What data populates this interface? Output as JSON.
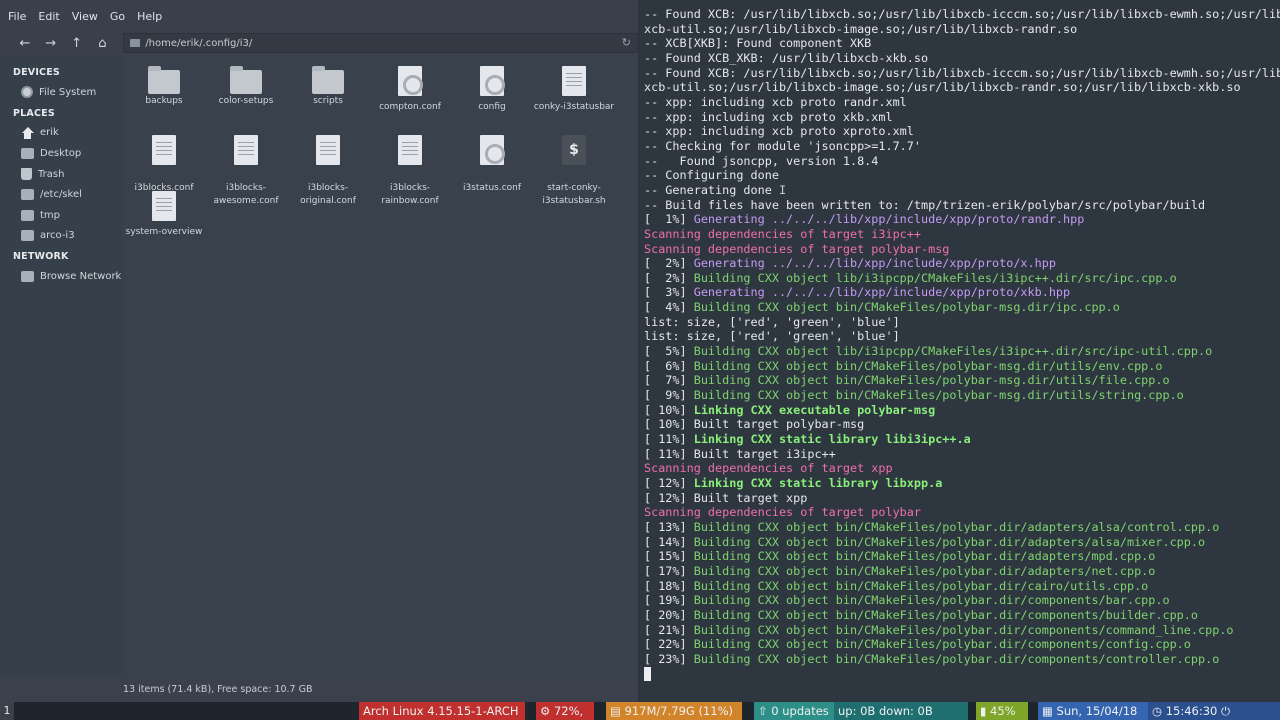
{
  "file_manager": {
    "menu": [
      "File",
      "Edit",
      "View",
      "Go",
      "Help"
    ],
    "path": "/home/erik/.config/i3/",
    "sidebar": {
      "devices_heading": "DEVICES",
      "devices": [
        "File System"
      ],
      "places_heading": "PLACES",
      "places": [
        "erik",
        "Desktop",
        "Trash",
        "/etc/skel",
        "tmp",
        "arco-i3"
      ],
      "network_heading": "NETWORK",
      "network": [
        "Browse Network"
      ]
    },
    "files": [
      {
        "name": "backups",
        "icon": "folder-icon"
      },
      {
        "name": "color-setups",
        "icon": "folder-icon"
      },
      {
        "name": "scripts",
        "icon": "folder-icon"
      },
      {
        "name": "compton.conf",
        "icon": "config-file-icon"
      },
      {
        "name": "config",
        "icon": "config-file-icon"
      },
      {
        "name": "conky-i3statusbar",
        "icon": "text-file-icon"
      },
      {
        "name": "i3blocks.conf",
        "icon": "text-file-icon"
      },
      {
        "name": "i3blocks-\nawesome.conf",
        "icon": "text-file-icon"
      },
      {
        "name": "i3blocks-\noriginal.conf",
        "icon": "text-file-icon"
      },
      {
        "name": "i3blocks-\nrainbow.conf",
        "icon": "text-file-icon"
      },
      {
        "name": "i3status.conf",
        "icon": "config-file-icon"
      },
      {
        "name": "start-conky-\ni3statusbar.sh",
        "icon": "shell-script-icon"
      },
      {
        "name": "system-overview",
        "icon": "text-file-icon"
      }
    ],
    "status": "13 items (71.4 kB), Free space: 10.7 GB"
  },
  "terminal": {
    "lines": [
      [
        [
          "",
          "-- Found XCB: /usr/lib/libxcb.so;/usr/lib/libxcb-icccm.so;/usr/lib/libxcb-ewmh.so;/usr/lib/lib"
        ]
      ],
      [
        [
          "",
          "xcb-util.so;/usr/lib/libxcb-image.so;/usr/lib/libxcb-randr.so"
        ]
      ],
      [
        [
          "",
          "-- XCB[XKB]: Found component XKB"
        ]
      ],
      [
        [
          "",
          "-- Found XCB_XKB: /usr/lib/libxcb-xkb.so"
        ]
      ],
      [
        [
          "",
          "-- Found XCB: /usr/lib/libxcb.so;/usr/lib/libxcb-icccm.so;/usr/lib/libxcb-ewmh.so;/usr/lib/lib"
        ]
      ],
      [
        [
          "",
          "xcb-util.so;/usr/lib/libxcb-image.so;/usr/lib/libxcb-randr.so;/usr/lib/libxcb-xkb.so"
        ]
      ],
      [
        [
          "",
          "-- xpp: including xcb proto randr.xml"
        ]
      ],
      [
        [
          "",
          "-- xpp: including xcb proto xkb.xml"
        ]
      ],
      [
        [
          "",
          "-- xpp: including xcb proto xproto.xml"
        ]
      ],
      [
        [
          "",
          "-- Checking for module 'jsoncpp>=1.7.7'"
        ]
      ],
      [
        [
          "",
          "--   Found jsoncpp, version 1.8.4"
        ]
      ],
      [
        [
          "",
          "-- Configuring done"
        ]
      ],
      [
        [
          "",
          "-- Generating done "
        ],
        [
          "ibeam",
          "I"
        ]
      ],
      [
        [
          "",
          "-- Build files have been written to: /tmp/trizen-erik/polybar/src/polybar/build"
        ]
      ],
      [
        [
          "",
          "[  1%] "
        ],
        [
          "purple",
          "Generating ../../../lib/xpp/include/xpp/proto/randr.hpp"
        ]
      ],
      [
        [
          "pink",
          "Scanning dependencies of target i3ipc++"
        ]
      ],
      [
        [
          "pink",
          "Scanning dependencies of target polybar-msg"
        ]
      ],
      [
        [
          "",
          "[  2%] "
        ],
        [
          "purple",
          "Generating ../../../lib/xpp/include/xpp/proto/x.hpp"
        ]
      ],
      [
        [
          "",
          "[  2%] "
        ],
        [
          "green",
          "Building CXX object lib/i3ipcpp/CMakeFiles/i3ipc++.dir/src/ipc.cpp.o"
        ]
      ],
      [
        [
          "",
          "[  3%] "
        ],
        [
          "purple",
          "Generating ../../../lib/xpp/include/xpp/proto/xkb.hpp"
        ]
      ],
      [
        [
          "",
          "[  4%] "
        ],
        [
          "green",
          "Building CXX object bin/CMakeFiles/polybar-msg.dir/ipc.cpp.o"
        ]
      ],
      [
        [
          "",
          "list: size, ['red', 'green', 'blue']"
        ]
      ],
      [
        [
          "",
          "list: size, ['red', 'green', 'blue']"
        ]
      ],
      [
        [
          "",
          "[  5%] "
        ],
        [
          "green",
          "Building CXX object lib/i3ipcpp/CMakeFiles/i3ipc++.dir/src/ipc-util.cpp.o"
        ]
      ],
      [
        [
          "",
          "[  6%] "
        ],
        [
          "green",
          "Building CXX object bin/CMakeFiles/polybar-msg.dir/utils/env.cpp.o"
        ]
      ],
      [
        [
          "",
          "[  7%] "
        ],
        [
          "green",
          "Building CXX object bin/CMakeFiles/polybar-msg.dir/utils/file.cpp.o"
        ]
      ],
      [
        [
          "",
          "[  9%] "
        ],
        [
          "green",
          "Building CXX object bin/CMakeFiles/polybar-msg.dir/utils/string.cpp.o"
        ]
      ],
      [
        [
          "",
          "[ 10%] "
        ],
        [
          "bgreen",
          "Linking CXX executable polybar-msg"
        ]
      ],
      [
        [
          "",
          "[ 10%] Built target polybar-msg"
        ]
      ],
      [
        [
          "",
          "[ 11%] "
        ],
        [
          "bgreen",
          "Linking CXX static library libi3ipc++.a"
        ]
      ],
      [
        [
          "",
          "[ 11%] Built target i3ipc++"
        ]
      ],
      [
        [
          "pink",
          "Scanning dependencies of target xpp"
        ]
      ],
      [
        [
          "",
          "[ 12%] "
        ],
        [
          "bgreen",
          "Linking CXX static library libxpp.a"
        ]
      ],
      [
        [
          "",
          "[ 12%] Built target xpp"
        ]
      ],
      [
        [
          "pink",
          "Scanning dependencies of target polybar"
        ]
      ],
      [
        [
          "",
          "[ 13%] "
        ],
        [
          "green",
          "Building CXX object bin/CMakeFiles/polybar.dir/adapters/alsa/control.cpp.o"
        ]
      ],
      [
        [
          "",
          "[ 14%] "
        ],
        [
          "green",
          "Building CXX object bin/CMakeFiles/polybar.dir/adapters/alsa/mixer.cpp.o"
        ]
      ],
      [
        [
          "",
          "[ 15%] "
        ],
        [
          "green",
          "Building CXX object bin/CMakeFiles/polybar.dir/adapters/mpd.cpp.o"
        ]
      ],
      [
        [
          "",
          "[ 17%] "
        ],
        [
          "green",
          "Building CXX object bin/CMakeFiles/polybar.dir/adapters/net.cpp.o"
        ]
      ],
      [
        [
          "",
          "[ 18%] "
        ],
        [
          "green",
          "Building CXX object bin/CMakeFiles/polybar.dir/cairo/utils.cpp.o"
        ]
      ],
      [
        [
          "",
          "[ 19%] "
        ],
        [
          "green",
          "Building CXX object bin/CMakeFiles/polybar.dir/components/bar.cpp.o"
        ]
      ],
      [
        [
          "",
          "[ 20%] "
        ],
        [
          "green",
          "Building CXX object bin/CMakeFiles/polybar.dir/components/builder.cpp.o"
        ]
      ],
      [
        [
          "",
          "[ 21%] "
        ],
        [
          "green",
          "Building CXX object bin/CMakeFiles/polybar.dir/components/command_line.cpp.o"
        ]
      ],
      [
        [
          "",
          "[ 22%] "
        ],
        [
          "green",
          "Building CXX object bin/CMakeFiles/polybar.dir/components/config.cpp.o"
        ]
      ],
      [
        [
          "",
          "[ 23%] "
        ],
        [
          "green",
          "Building CXX object bin/CMakeFiles/polybar.dir/components/controller.cpp.o"
        ]
      ]
    ]
  },
  "polybar": {
    "workspace": "1",
    "kernel": "Arch Linux 4.15.15-1-ARCH",
    "cpu": "72%,",
    "memory": "917M/7.79G (11%)",
    "updates": "0 updates",
    "network": "up:   0B down:   0B",
    "battery": "45%",
    "date": "Sun, 15/04/18",
    "time": "15:46:30",
    "colors": {
      "kernel": "#c0302f",
      "cpu": "#c0302f",
      "memory": "#d1842a",
      "updates": "#2d8f88",
      "network": "#1f6f70",
      "battery": "#7fa628",
      "date": "#3565b0",
      "time": "#2c4f8e"
    }
  }
}
